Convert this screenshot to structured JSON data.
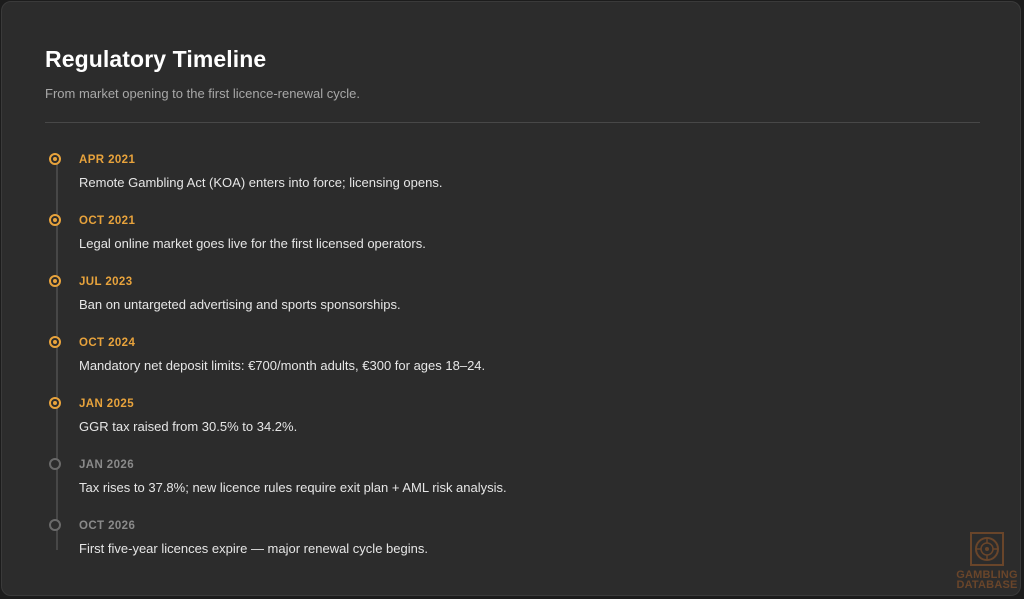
{
  "header": {
    "title": "Regulatory Timeline",
    "subtitle": "From market opening to the first licence-renewal cycle."
  },
  "colors": {
    "accent": "#e8a33c",
    "background": "#2c2c2c",
    "muted": "#8a8a8a",
    "text": "#e6e6e6"
  },
  "timeline": {
    "events": [
      {
        "date": "APR 2021",
        "description": "Remote Gambling Act (KOA) enters into force; licensing opens.",
        "status": "done"
      },
      {
        "date": "OCT 2021",
        "description": "Legal online market goes live for the first licensed operators.",
        "status": "done"
      },
      {
        "date": "JUL 2023",
        "description": "Ban on untargeted advertising and sports sponsorships.",
        "status": "done"
      },
      {
        "date": "OCT 2024",
        "description": "Mandatory net deposit limits: €700/month adults, €300 for ages 18–24.",
        "status": "done"
      },
      {
        "date": "JAN 2025",
        "description": "GGR tax raised from 30.5% to 34.2%.",
        "status": "done"
      },
      {
        "date": "JAN 2026",
        "description": "Tax rises to 37.8%; new licence rules require exit plan + AML risk analysis.",
        "status": "future"
      },
      {
        "date": "OCT 2026",
        "description": "First five-year licences expire — major renewal cycle begins.",
        "status": "future"
      }
    ]
  },
  "watermark": {
    "line1": "GAMBLING",
    "line2": "DATABASE"
  }
}
